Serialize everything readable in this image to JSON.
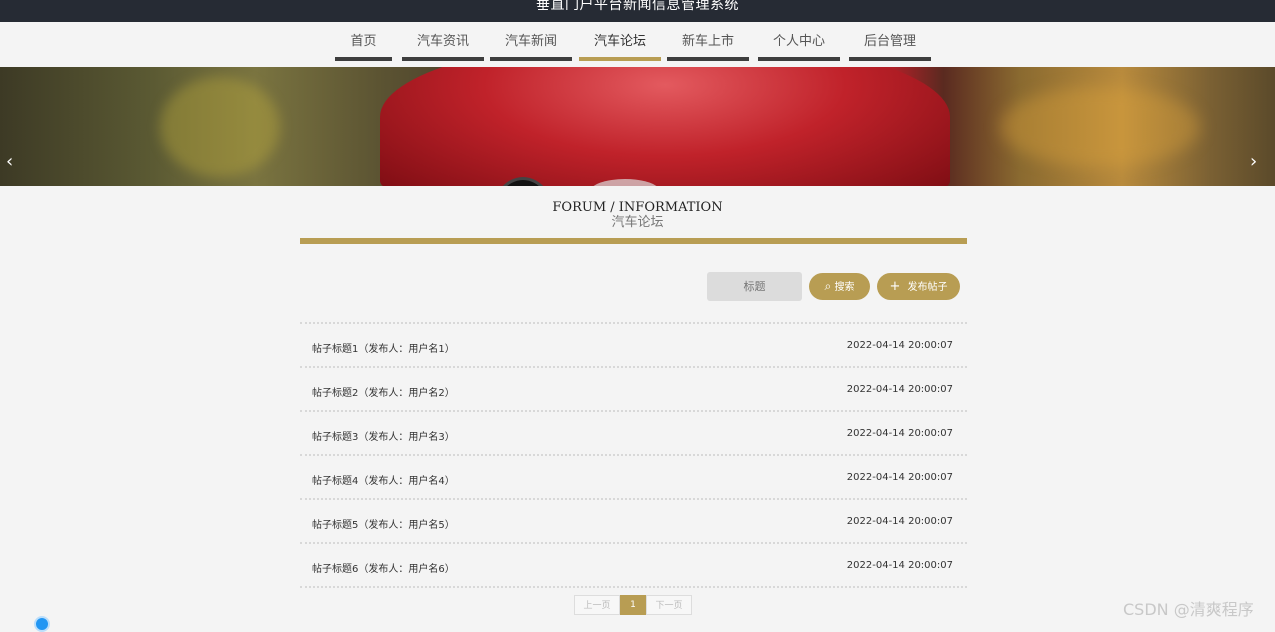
{
  "app": {
    "title": "垂直门户平台新闻信息管理系统"
  },
  "nav": {
    "items": [
      {
        "label": "首页",
        "active": false
      },
      {
        "label": "汽车资讯",
        "active": false
      },
      {
        "label": "汽车新闻",
        "active": false
      },
      {
        "label": "汽车论坛",
        "active": true
      },
      {
        "label": "新车上市",
        "active": false
      },
      {
        "label": "个人中心",
        "active": false
      },
      {
        "label": "后台管理",
        "active": false
      }
    ]
  },
  "banner": {
    "prev_icon": "chevron-left-icon",
    "next_icon": "chevron-right-icon",
    "prev_glyph": "‹",
    "next_glyph": "›"
  },
  "section": {
    "title_en": "FORUM / INFORMATION",
    "title_cn": "汽车论坛"
  },
  "search": {
    "placeholder": "标题",
    "search_label": "搜索",
    "post_label": "发布帖子",
    "search_glyph": "⌕",
    "post_glyph": "+"
  },
  "posts": [
    {
      "title": "帖子标题1（发布人：用户名1）",
      "date": "2022-04-14 20:00:07"
    },
    {
      "title": "帖子标题2（发布人：用户名2）",
      "date": "2022-04-14 20:00:07"
    },
    {
      "title": "帖子标题3（发布人：用户名3）",
      "date": "2022-04-14 20:00:07"
    },
    {
      "title": "帖子标题4（发布人：用户名4）",
      "date": "2022-04-14 20:00:07"
    },
    {
      "title": "帖子标题5（发布人：用户名5）",
      "date": "2022-04-14 20:00:07"
    },
    {
      "title": "帖子标题6（发布人：用户名6）",
      "date": "2022-04-14 20:00:07"
    }
  ],
  "pagination": {
    "prev": "上一页",
    "current": "1",
    "next": "下一页"
  },
  "watermark": "CSDN @清爽程序",
  "colors": {
    "accent": "#b89d53",
    "topbar": "#262b34"
  }
}
